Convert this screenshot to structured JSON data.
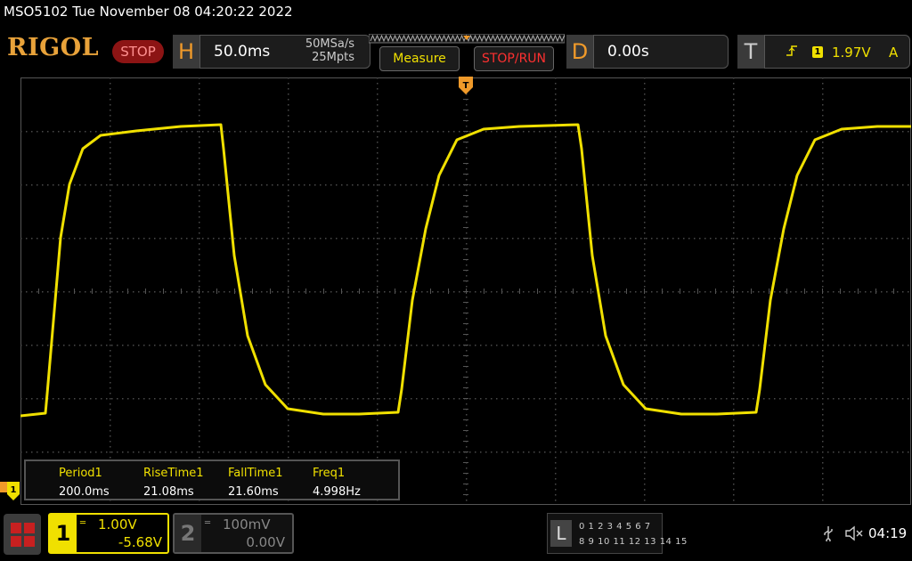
{
  "title_bar": {
    "text": "MSO5102  Tue November 08 04:20:22 2022"
  },
  "brand": "RIGOL",
  "run_state": "STOP",
  "horizontal": {
    "letter": "H",
    "timebase": "50.0ms",
    "sample_rate": "50MSa/s",
    "memory_depth": "25Mpts"
  },
  "buttons": {
    "measure": "Measure",
    "stop_run": "STOP/RUN"
  },
  "delay": {
    "letter": "D",
    "value": "0.00s"
  },
  "trigger": {
    "letter": "T",
    "channel": "1",
    "level": "1.97V",
    "mode": "A"
  },
  "trigger_marker": "T",
  "ground_marker": "1",
  "measurements": {
    "headers": [
      "Period1",
      "RiseTime1",
      "FallTime1",
      "Freq1"
    ],
    "values": [
      "200.0ms",
      "21.08ms",
      "21.60ms",
      "4.998Hz"
    ]
  },
  "channel1": {
    "number": "1",
    "scale": "1.00V",
    "offset": "-5.68V",
    "color": "#f0e000"
  },
  "channel2": {
    "number": "2",
    "scale": "100mV",
    "offset": "0.00V",
    "color": "#888888"
  },
  "logic": {
    "letter": "L",
    "row1": "0 1 2 3   4 5 6 7",
    "row2": "8  9 10 11  12 13 14 15"
  },
  "status": {
    "usb_icon": "usb-icon",
    "speaker_icon": "speaker-muted-icon",
    "clock": "04:19"
  },
  "colors": {
    "trace": "#f0e000",
    "grid": "#3c3c3c",
    "accent_orange": "#f09a2a",
    "stop_red": "#8c1414"
  }
}
